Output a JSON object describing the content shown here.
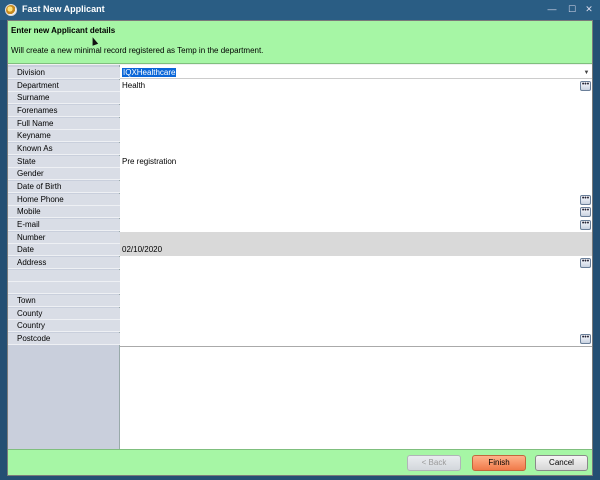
{
  "window": {
    "title": "Fast New Applicant",
    "controls": {
      "minimize": "—",
      "maximize": "☐",
      "close": "✕"
    }
  },
  "header": {
    "title": "Enter new Applicant details",
    "subtitle": "Will create a new minimal record registered as Temp in the department."
  },
  "fields": {
    "division": {
      "label": "Division",
      "value": "IQXHealthcare"
    },
    "department": {
      "label": "Department",
      "value": "Health"
    },
    "surname": {
      "label": "Surname",
      "value": ""
    },
    "forenames": {
      "label": "Forenames",
      "value": ""
    },
    "full_name": {
      "label": "Full Name",
      "value": ""
    },
    "keyname": {
      "label": "Keyname",
      "value": ""
    },
    "known_as": {
      "label": "Known As",
      "value": ""
    },
    "state": {
      "label": "State",
      "value": "Pre registration"
    },
    "gender": {
      "label": "Gender",
      "value": ""
    },
    "dob": {
      "label": "Date of Birth",
      "value": ""
    },
    "home_phone": {
      "label": "Home Phone",
      "value": ""
    },
    "mobile": {
      "label": "Mobile",
      "value": ""
    },
    "email": {
      "label": "E-mail",
      "value": ""
    },
    "number": {
      "label": "Number",
      "value": ""
    },
    "date": {
      "label": "Date",
      "value": "02/10/2020"
    },
    "address": {
      "label": "Address",
      "value": ""
    },
    "town": {
      "label": "Town",
      "value": ""
    },
    "county": {
      "label": "County",
      "value": ""
    },
    "country": {
      "label": "Country",
      "value": ""
    },
    "postcode": {
      "label": "Postcode",
      "value": ""
    }
  },
  "buttons": {
    "ellipsis": "•••",
    "dropdown": "▼",
    "back": "< Back",
    "finish": "Finish",
    "cancel": "Cancel"
  },
  "colors": {
    "header_bg": "#a6f6a5",
    "titlebar_bg": "#2a5d84",
    "finish_bg": "#f07a4a",
    "selection": "#0a66d8"
  }
}
